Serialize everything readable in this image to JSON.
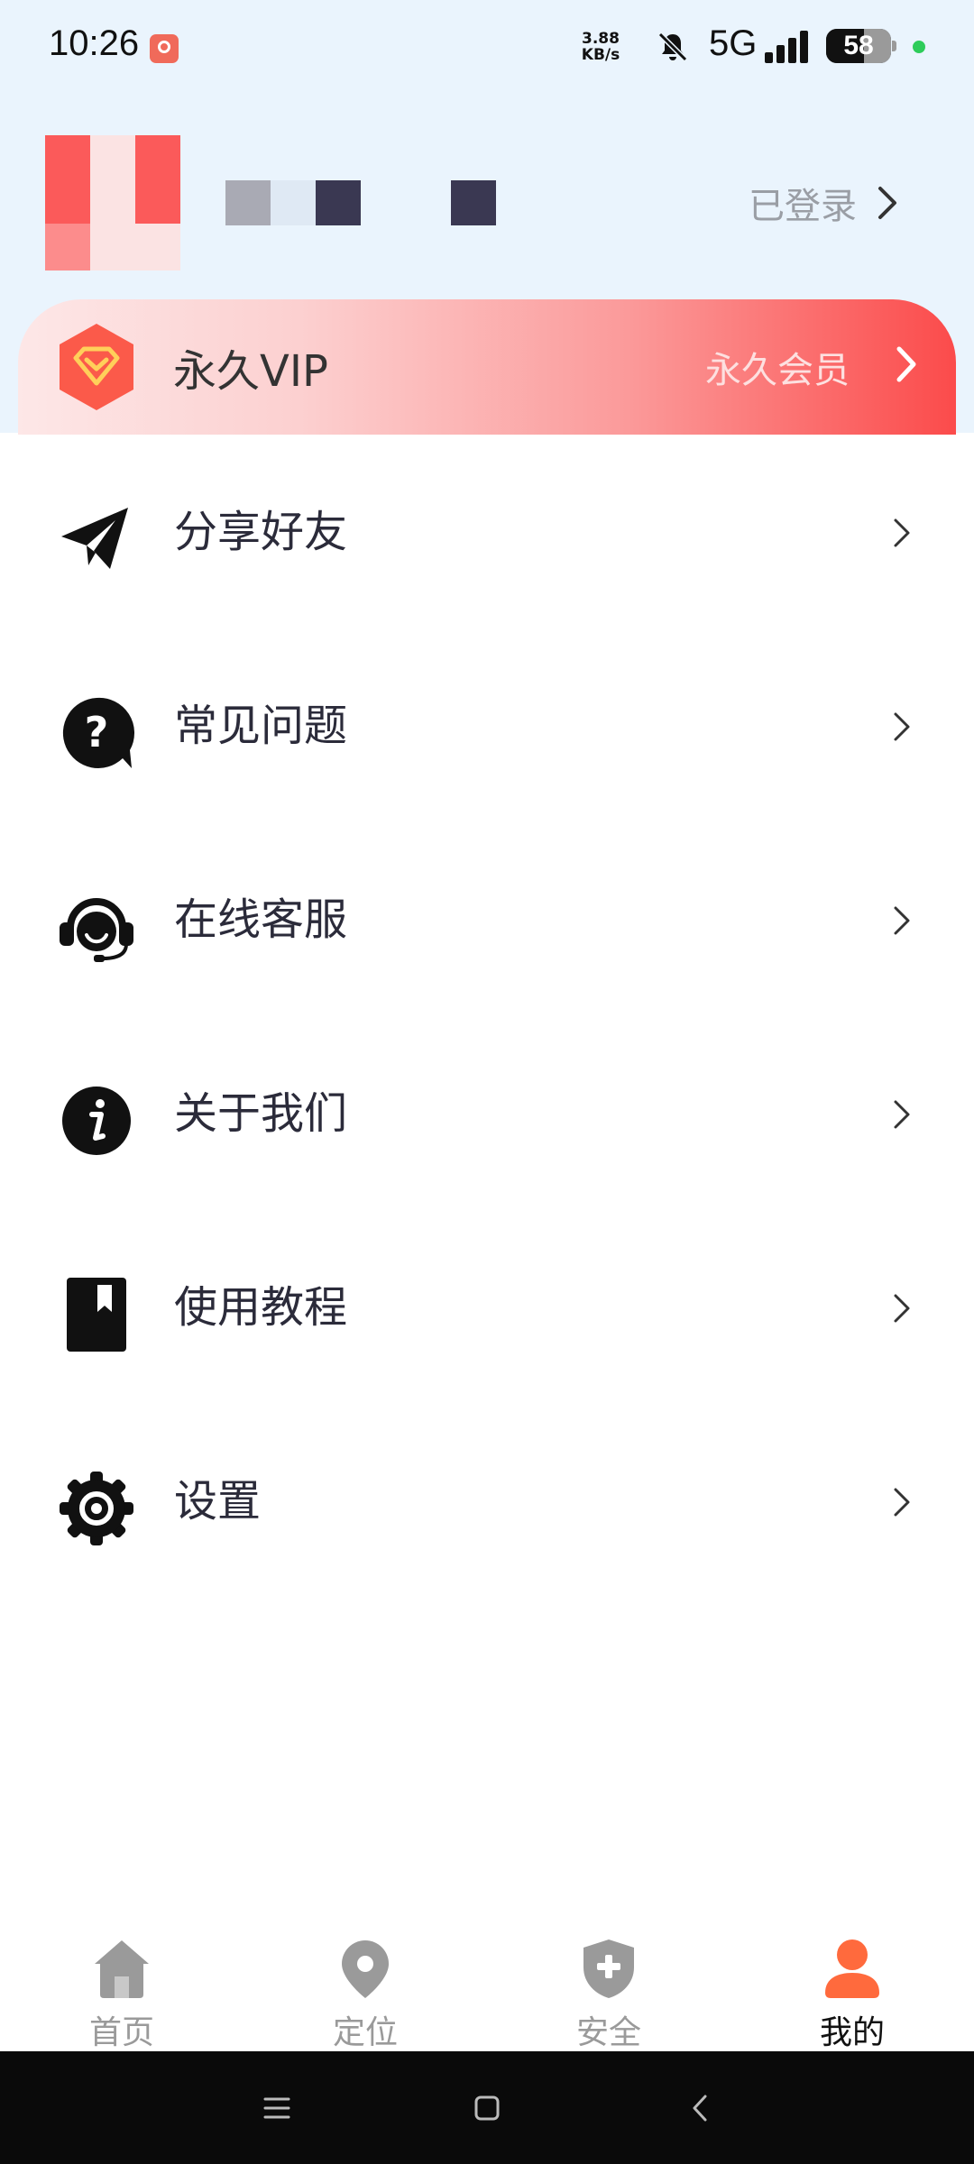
{
  "status_bar": {
    "time": "10:26",
    "net_speed": "3.88\nKB/s",
    "network": "5G",
    "battery": "58",
    "battery_level": 0.58
  },
  "profile": {
    "login_status": "已登录"
  },
  "vip": {
    "title": "永久VIP",
    "subtitle": "永久会员"
  },
  "menu": [
    {
      "label": "分享好友",
      "icon": "paper-plane-icon"
    },
    {
      "label": "常见问题",
      "icon": "question-icon"
    },
    {
      "label": "在线客服",
      "icon": "headset-icon"
    },
    {
      "label": "关于我们",
      "icon": "info-icon"
    },
    {
      "label": "使用教程",
      "icon": "bookmark-book-icon"
    },
    {
      "label": "设置",
      "icon": "gear-icon"
    }
  ],
  "bottom_nav": [
    {
      "label": "首页",
      "icon": "home-icon",
      "active": false
    },
    {
      "label": "定位",
      "icon": "location-pin-icon",
      "active": false
    },
    {
      "label": "安全",
      "icon": "shield-icon",
      "active": false
    },
    {
      "label": "我的",
      "icon": "person-icon",
      "active": true
    }
  ],
  "colors": {
    "accent": "#fb4b4b",
    "active_nav": "#ff6a3d",
    "inactive_nav": "#9a9a9a"
  }
}
